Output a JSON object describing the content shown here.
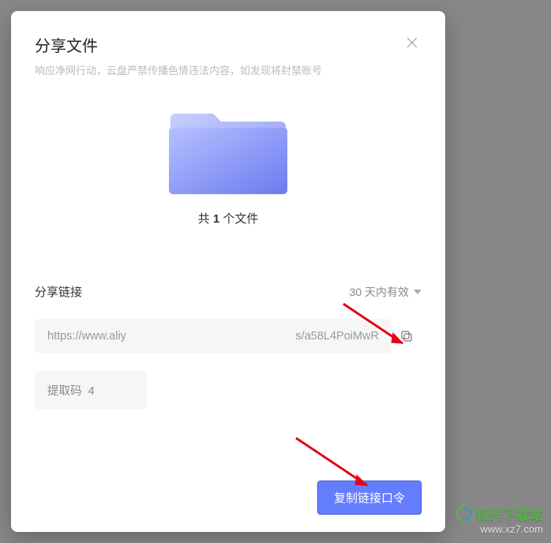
{
  "title": "分享文件",
  "subtitle": "响应净网行动，云盘严禁传播色情违法内容，如发现将封禁账号",
  "file_count_prefix": "共 ",
  "file_count_number": "1",
  "file_count_suffix": " 个文件",
  "share_link_label": "分享链接",
  "expiry_label": "30 天内有效",
  "link_part1": "https://www.aliy",
  "link_part2": "s/a58L4PoiMwR",
  "code_label": "提取码",
  "code_value": "4",
  "copy_button_label": "复制链接口令",
  "watermark": {
    "name": "极光下载站",
    "url": "www.xz7.com"
  }
}
